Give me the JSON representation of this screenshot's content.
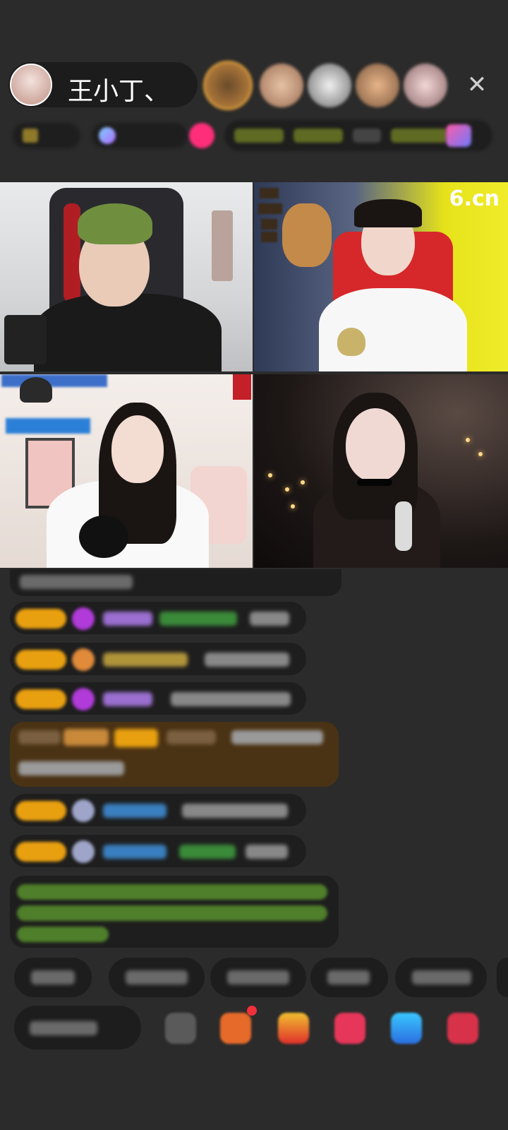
{
  "header": {
    "host_name": "王小丁、",
    "close_glyph": "✕",
    "viewers": [
      "viewer-1",
      "viewer-2",
      "viewer-3",
      "viewer-4",
      "viewer-5"
    ]
  },
  "streams": {
    "stream_2_logo": "6.cn"
  },
  "colors": {
    "background": "#2b2b2b",
    "badge": "#e9a010",
    "chat_bubble": "#1e1e1e",
    "highlight_bubble": "#4a3214",
    "notice_green": "#6bbf3a"
  }
}
